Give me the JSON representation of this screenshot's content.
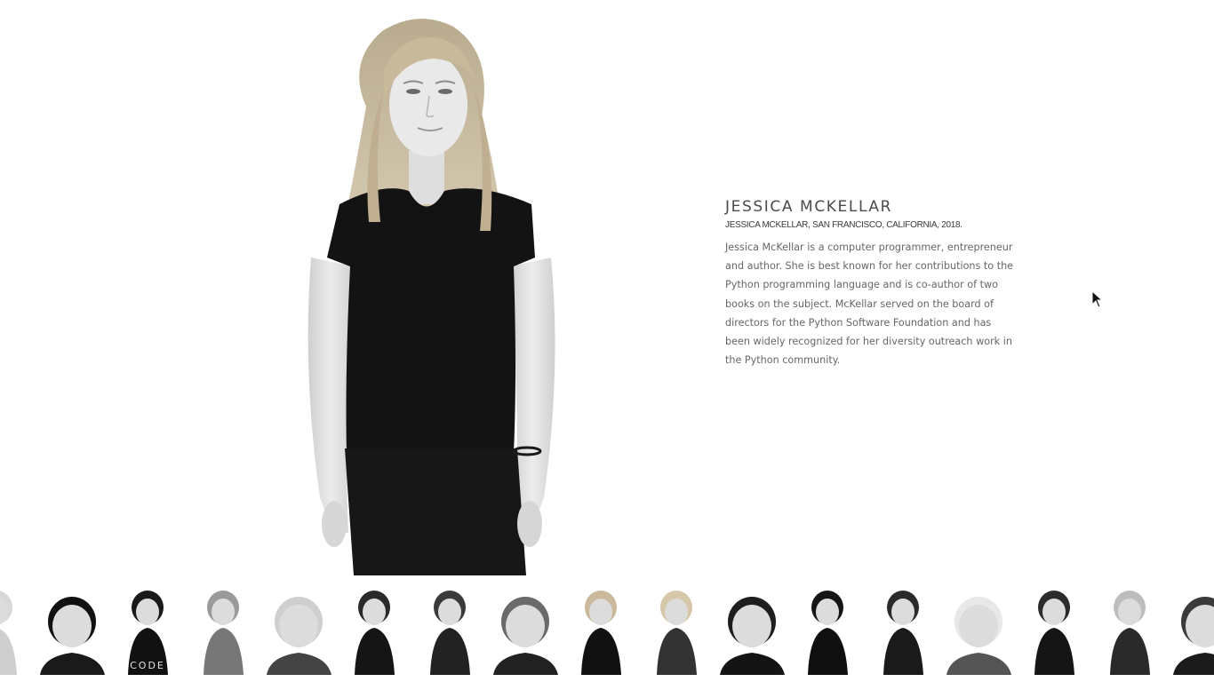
{
  "person": {
    "name": "JESSICA MCKELLAR",
    "caption": "JESSICA MCKELLAR, SAN FRANCISCO, CALIFORNIA, 2018.",
    "bio": "Jessica McKellar is a computer programmer, entrepreneur and author. She is best known for her contributions to the Python programming language and is co-author of two books on the subject. McKellar served on the board of directors for the Python Software Foundation and has been widely recognized for her diversity outreach work in the Python community."
  },
  "thumbnails": [
    {
      "hair": "#d8d8d8",
      "top": "#cfcfcf",
      "shirt_text": ""
    },
    {
      "hair": "#111111",
      "top": "#1a1a1a",
      "shirt_text": ""
    },
    {
      "hair": "#1a1a1a",
      "top": "#111111",
      "shirt_text": "CODE"
    },
    {
      "hair": "#9a9a9a",
      "top": "#777777",
      "shirt_text": ""
    },
    {
      "hair": "#cfcfcf",
      "top": "#444444",
      "shirt_text": ""
    },
    {
      "hair": "#2a2a2a",
      "top": "#151515",
      "shirt_text": ""
    },
    {
      "hair": "#3a3a3a",
      "top": "#222222",
      "shirt_text": ""
    },
    {
      "hair": "#6a6a6a",
      "top": "#222222",
      "shirt_text": ""
    },
    {
      "hair": "#c9b89a",
      "top": "#111111",
      "shirt_text": ""
    },
    {
      "hair": "#d6c7a9",
      "top": "#333333",
      "shirt_text": ""
    },
    {
      "hair": "#1e1e1e",
      "top": "#141414",
      "shirt_text": ""
    },
    {
      "hair": "#151515",
      "top": "#0f0f0f",
      "shirt_text": ""
    },
    {
      "hair": "#2a2a2a",
      "top": "#1a1a1a",
      "shirt_text": ""
    },
    {
      "hair": "#e8e8e8",
      "top": "#555555",
      "shirt_text": ""
    },
    {
      "hair": "#2c2c2c",
      "top": "#151515",
      "shirt_text": ""
    },
    {
      "hair": "#bdbdbd",
      "top": "#2a2a2a",
      "shirt_text": ""
    },
    {
      "hair": "#3a3a3a",
      "top": "#1a1a1a",
      "shirt_text": ""
    }
  ]
}
